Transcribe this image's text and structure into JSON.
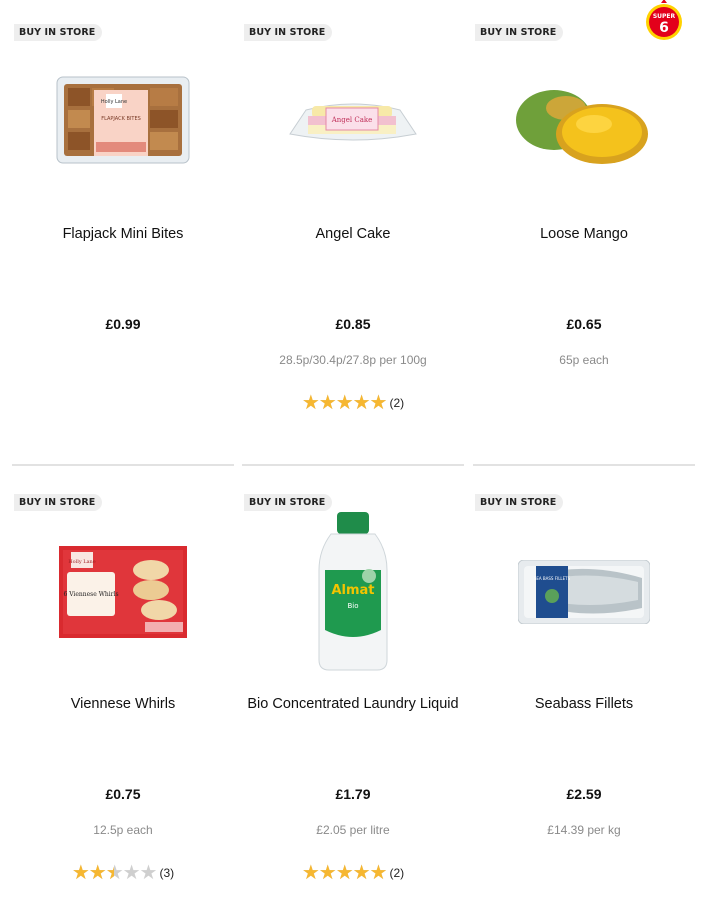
{
  "products": [
    {
      "badge": "BUY IN STORE",
      "name": "Flapjack Mini Bites",
      "price": "£0.99",
      "unit": "",
      "rating": null,
      "review_count": "",
      "image": "flapjack-box-image"
    },
    {
      "badge": "BUY IN STORE",
      "name": "Angel Cake",
      "price": "£0.85",
      "unit": "28.5p/30.4p/27.8p per 100g",
      "rating": 5,
      "review_count": "(2)",
      "image": "angel-cake-image"
    },
    {
      "badge": "BUY IN STORE",
      "name": "Loose Mango",
      "price": "£0.65",
      "unit": "65p each",
      "rating": null,
      "review_count": "",
      "image": "mango-image",
      "super_badge": "SUPER 6"
    },
    {
      "badge": "BUY IN STORE",
      "name": "Viennese Whirls",
      "price": "£0.75",
      "unit": "12.5p each",
      "rating": 2.5,
      "review_count": "(3)",
      "image": "viennese-whirls-box-image"
    },
    {
      "badge": "BUY IN STORE",
      "name": "Bio Concentrated Laundry Liquid",
      "price": "£1.79",
      "unit": "£2.05 per litre",
      "rating": 5,
      "review_count": "(2)",
      "image": "laundry-bottle-image"
    },
    {
      "badge": "BUY IN STORE",
      "name": "Seabass Fillets",
      "price": "£2.59",
      "unit": "£14.39 per kg",
      "rating": null,
      "review_count": "",
      "image": "seabass-pack-image"
    }
  ],
  "package_text": {
    "flapjack_brand": "Holly Lane",
    "flapjack_label": "FLAPJACK BITES",
    "angel_label": "Angel Cake",
    "viennese_brand": "Holly Lane",
    "viennese_label": "6 Viennese Whirls",
    "laundry_brand": "Almat",
    "laundry_sub": "Bio",
    "seabass_label": "SEA BASS FILLETS"
  },
  "super6": {
    "top": "SUPER",
    "num": "6"
  },
  "colors": {
    "star": "#f6b731",
    "star_empty": "#cfcfcf",
    "badge_bg": "#eeeeee",
    "super_red": "#e3001b",
    "super_yellow": "#ffd200"
  }
}
